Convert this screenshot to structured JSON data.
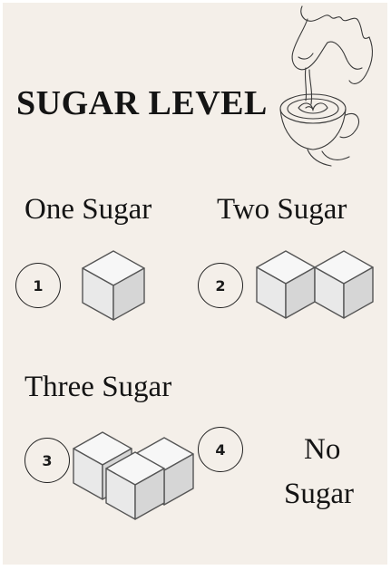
{
  "title": "SUGAR LEVEL",
  "options": [
    {
      "label": "One Sugar",
      "number": "1",
      "cubes": 1
    },
    {
      "label": "Two Sugar",
      "number": "2",
      "cubes": 2
    },
    {
      "label": "Three Sugar",
      "number": "3",
      "cubes": 3
    },
    {
      "label_lines": [
        "No",
        "Sugar"
      ],
      "number": "4",
      "cubes": 0
    }
  ],
  "icons": {
    "illustration": "coffee-pour-line-art-icon",
    "cube": "sugar-cube-icon"
  },
  "colors": {
    "background": "#f4efe9",
    "text": "#141414",
    "cube_top": "#f7f7f7",
    "cube_left": "#e9e9e9",
    "cube_right": "#d6d6d6",
    "cube_stroke": "#555555"
  }
}
